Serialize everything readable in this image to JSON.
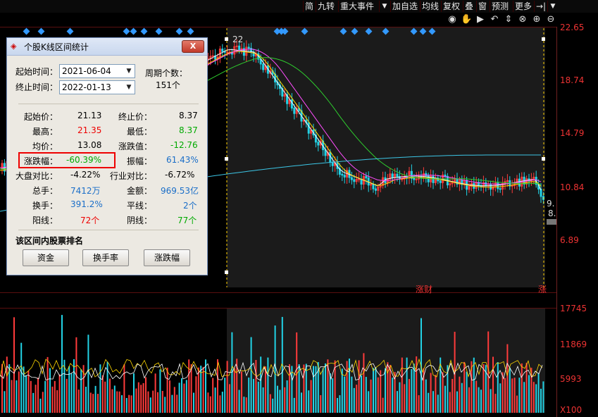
{
  "toolbar": {
    "items": [
      "简",
      "九转",
      "重大事件",
      "加自选",
      "均线",
      "复权",
      "叠",
      "窗",
      "预测",
      "更多"
    ],
    "more_label": "→|"
  },
  "icons": [
    "eye-icon",
    "hand-icon",
    "play-icon",
    "undo-icon",
    "chevron-down-icon",
    "zoom-in-icon",
    "zoom-out-icon"
  ],
  "price_axis": [
    "22.65",
    "18.74",
    "14.79",
    "10.84",
    "6.89"
  ],
  "volume_axis": [
    "17745",
    "11869",
    "5993",
    "X100"
  ],
  "chart_labels": {
    "high_marker": "22",
    "right_marker_1": "9.",
    "right_marker_2": "8.",
    "zhangcai": "涨财",
    "bottom_right": "涨"
  },
  "dialog": {
    "title": "个股K线区间统计",
    "start_label": "起始时间：",
    "start_value": "2021-06-04",
    "end_label": "终止时间：",
    "end_value": "2022-01-13",
    "period_label": "周期个数：",
    "period_value": "151个",
    "stats": [
      {
        "label": "起始价：",
        "value": "21.13",
        "color": "blk"
      },
      {
        "label": "终止价：",
        "value": "8.37",
        "color": "blk"
      },
      {
        "label": "最高：",
        "value": "21.35",
        "color": "red"
      },
      {
        "label": "最低：",
        "value": "8.37",
        "color": "green"
      },
      {
        "label": "均价：",
        "value": "13.08",
        "color": "blk"
      },
      {
        "label": "涨跌值：",
        "value": "-12.76",
        "color": "green"
      },
      {
        "label": "涨跌幅：",
        "value": "-60.39%",
        "color": "green"
      },
      {
        "label": "振幅：",
        "value": "61.43%",
        "color": "blue"
      },
      {
        "label": "大盘对比：",
        "value": "-4.22%",
        "color": "blk"
      },
      {
        "label": "行业对比：",
        "value": "-6.72%",
        "color": "blk"
      },
      {
        "label": "总手：",
        "value": "7412万",
        "color": "blue"
      },
      {
        "label": "金额：",
        "value": "969.53亿",
        "color": "blue"
      },
      {
        "label": "换手：",
        "value": "391.2%",
        "color": "blue"
      },
      {
        "label": "平线：",
        "value": "2个",
        "color": "blue"
      },
      {
        "label": "阳线：",
        "value": "72个",
        "color": "red"
      },
      {
        "label": "阴线：",
        "value": "77个",
        "color": "green"
      }
    ],
    "rank_title": "该区间内股票排名",
    "buttons": [
      "资金",
      "换手率",
      "涨跌幅"
    ],
    "close_label": "X"
  }
}
